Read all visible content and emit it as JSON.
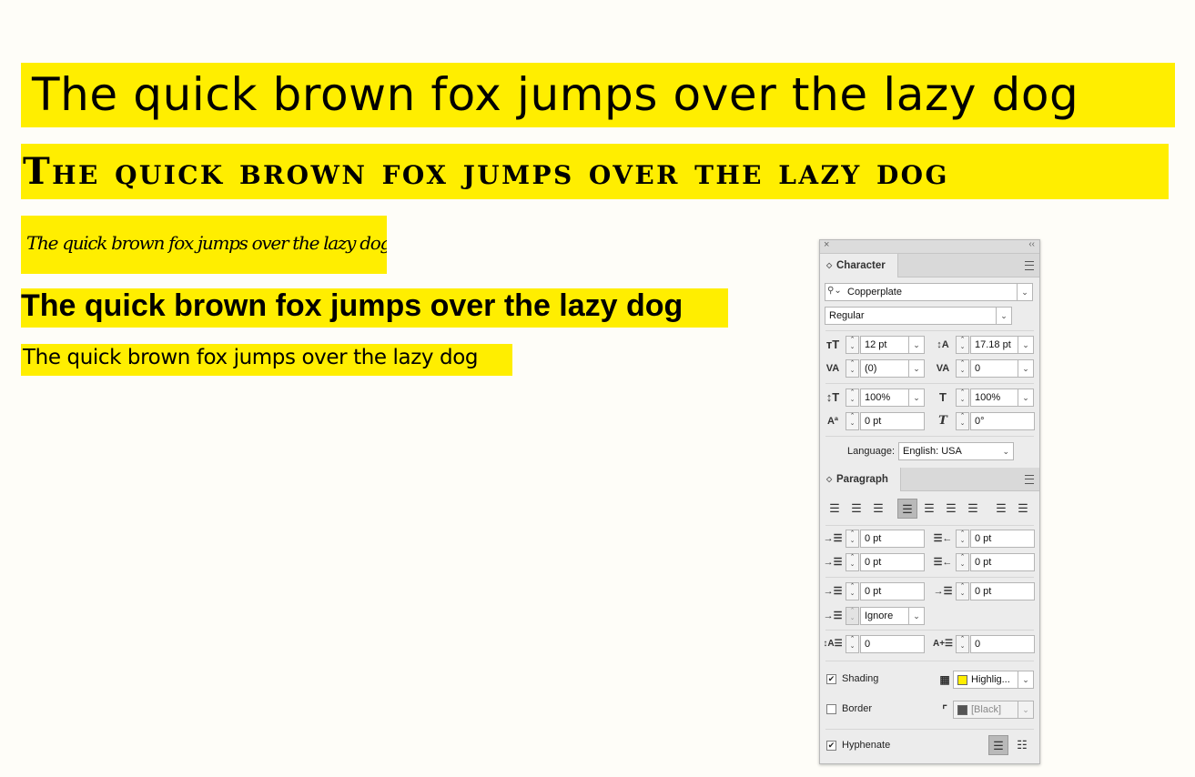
{
  "samples": [
    "The quick brown fox jumps over the lazy dog",
    "The quick brown fox jumps over the lazy dog",
    "The quick brown fox jumps over the lazy dog",
    "The quick brown fox jumps over the lazy dog",
    "The quick brown fox jumps over the lazy dog"
  ],
  "colors": {
    "highlight": "#ffee00",
    "background": "#fefdf8"
  },
  "panel": {
    "close_glyph": "×",
    "collapse_glyph": "‹‹",
    "character": {
      "tab_label": "Character",
      "font_family": "Copperplate",
      "font_style": "Regular",
      "font_size": "12 pt",
      "leading": "17.18 pt",
      "kerning": "(0)",
      "tracking": "0",
      "vertical_scale": "100%",
      "horizontal_scale": "100%",
      "baseline_shift": "0 pt",
      "skew": "0°",
      "language_label": "Language:",
      "language": "English: USA"
    },
    "paragraph": {
      "tab_label": "Paragraph",
      "left_indent": "0 pt",
      "right_indent": "0 pt",
      "first_line_indent": "0 pt",
      "last_line_indent": "0 pt",
      "space_before": "0 pt",
      "space_after": "0 pt",
      "align_to_grid": "Ignore",
      "drop_cap_lines": "0",
      "drop_cap_chars": "0",
      "shading_label": "Shading",
      "shading_color": "Highlig...",
      "shading_checked": true,
      "border_label": "Border",
      "border_color": "[Black]",
      "border_checked": false,
      "hyphenate_label": "Hyphenate",
      "hyphenate_checked": true,
      "alignment_selected": "left-justify"
    },
    "icons": {
      "shading_swatch": "#ffee00",
      "border_swatch": "#555555"
    }
  }
}
